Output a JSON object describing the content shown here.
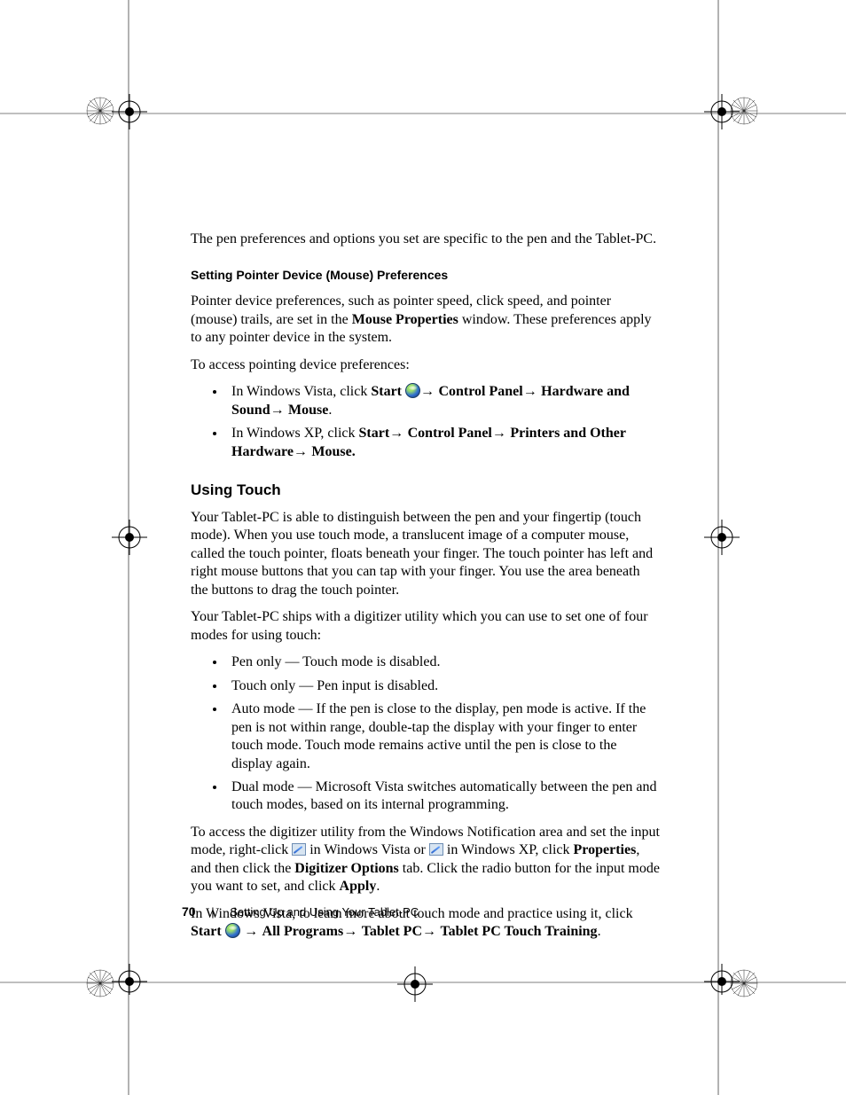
{
  "intro": "The pen preferences and options you set are specific to the pen and the Tablet-PC.",
  "section1": {
    "heading": "Setting Pointer Device (Mouse) Preferences",
    "para1_pre": "Pointer device preferences, such as pointer speed, click speed, and pointer (mouse) trails, are set in the ",
    "para1_bold": "Mouse Properties",
    "para1_post": " window. These preferences apply to any pointer device in the system.",
    "para2": "To access pointing device preferences:",
    "li1_pre": "In Windows Vista, click ",
    "li1_start": "Start ",
    "li1_arrow1": "→ ",
    "li1_cp": "Control Panel",
    "li1_arrow2": "→ ",
    "li1_hw": "Hardware and Sound",
    "li1_arrow3": "→ ",
    "li1_mouse": "Mouse",
    "li1_end": ".",
    "li2_pre": "In Windows XP, click ",
    "li2_start": "Start",
    "li2_arrow1": "→ ",
    "li2_cp": "Control Panel",
    "li2_arrow2": "→ ",
    "li2_printers": "Printers and Other Hardware",
    "li2_arrow3": "→ ",
    "li2_mouse": "Mouse."
  },
  "section2": {
    "heading": "Using Touch",
    "para1": "Your Tablet-PC is able to distinguish between the pen and your fingertip (touch mode). When you use touch mode, a translucent image of a computer mouse, called the touch pointer, floats beneath your finger. The touch pointer has left and right mouse buttons that you can tap with your finger. You use the area beneath the buttons to drag the touch pointer.",
    "para2": "Your Tablet-PC ships with a digitizer utility which you can use to set one of four modes for using touch:",
    "modes": [
      "Pen only — Touch mode is disabled.",
      "Touch only — Pen input is disabled.",
      "Auto mode — If the pen is close to the display, pen mode is active. If the pen is not within range, double-tap the display with your finger to enter touch mode. Touch mode remains active until the pen is close to the display again.",
      "Dual mode — Microsoft Vista switches automatically between the pen and touch modes, based on its internal programming."
    ],
    "para3_a": "To access the digitizer utility from the Windows Notification area and set the input mode, right-click ",
    "para3_b": " in Windows Vista or ",
    "para3_c": " in Windows XP, click ",
    "para3_props": "Properties",
    "para3_d": ", and then click the ",
    "para3_tab": "Digitizer Options",
    "para3_e": " tab. Click the radio button for the input mode you want to set, and click ",
    "para3_apply": "Apply",
    "para3_f": ".",
    "para4_a": "In Windows Vista, to learn more about touch mode and practice using it, click ",
    "para4_start": "Start ",
    "para4_arrow1": " → ",
    "para4_allprog": "All Programs",
    "para4_arrow2": "→ ",
    "para4_tpc": "Tablet PC",
    "para4_arrow3": "→ ",
    "para4_training": "Tablet PC Touch Training",
    "para4_end": "."
  },
  "footer": {
    "page": "70",
    "chapter": "Setting Up and Using Your Tablet-PC"
  }
}
